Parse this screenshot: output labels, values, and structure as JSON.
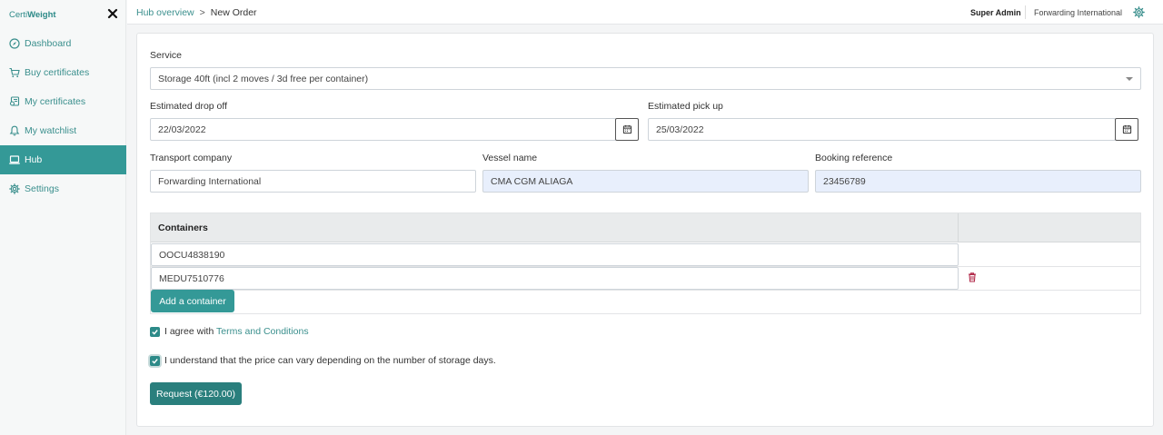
{
  "brand": {
    "part1": "Certi",
    "part2": "Weight"
  },
  "sidebar": {
    "items": [
      {
        "label": "Dashboard",
        "icon": "compass-icon"
      },
      {
        "label": "Buy certificates",
        "icon": "cart-icon"
      },
      {
        "label": "My certificates",
        "icon": "certificate-icon"
      },
      {
        "label": "My watchlist",
        "icon": "bell-icon"
      },
      {
        "label": "Hub",
        "icon": "laptop-icon",
        "active": true
      },
      {
        "label": "Settings",
        "icon": "gear-icon"
      }
    ]
  },
  "breadcrumb": {
    "parent": "Hub overview",
    "separator": ">",
    "current": "New Order"
  },
  "header": {
    "user": "Super Admin",
    "organization": "Forwarding International"
  },
  "form": {
    "service_label": "Service",
    "service_value": "Storage 40ft (incl 2 moves / 3d free per container)",
    "drop_off_label": "Estimated drop off",
    "drop_off_value": "22/03/2022",
    "pick_up_label": "Estimated pick up",
    "pick_up_value": "25/03/2022",
    "transport_label": "Transport company",
    "transport_value": "Forwarding International",
    "vessel_label": "Vessel name",
    "vessel_value": "CMA CGM ALIAGA",
    "booking_label": "Booking reference",
    "booking_value": "23456789"
  },
  "containers": {
    "header": "Containers",
    "rows": [
      "OOCU4838190",
      "MEDU7510776"
    ],
    "add_label": "Add a container"
  },
  "agreements": {
    "terms_prefix": "I agree with",
    "terms_link": "Terms and Conditions",
    "price_notice": "I understand that the price can vary depending on the number of storage days."
  },
  "submit": {
    "label": "Request (€120.00)"
  },
  "colors": {
    "accent": "#349997",
    "accent_dark": "#2a7f7d",
    "link": "#3a8f8d",
    "danger": "#b22a4a"
  }
}
